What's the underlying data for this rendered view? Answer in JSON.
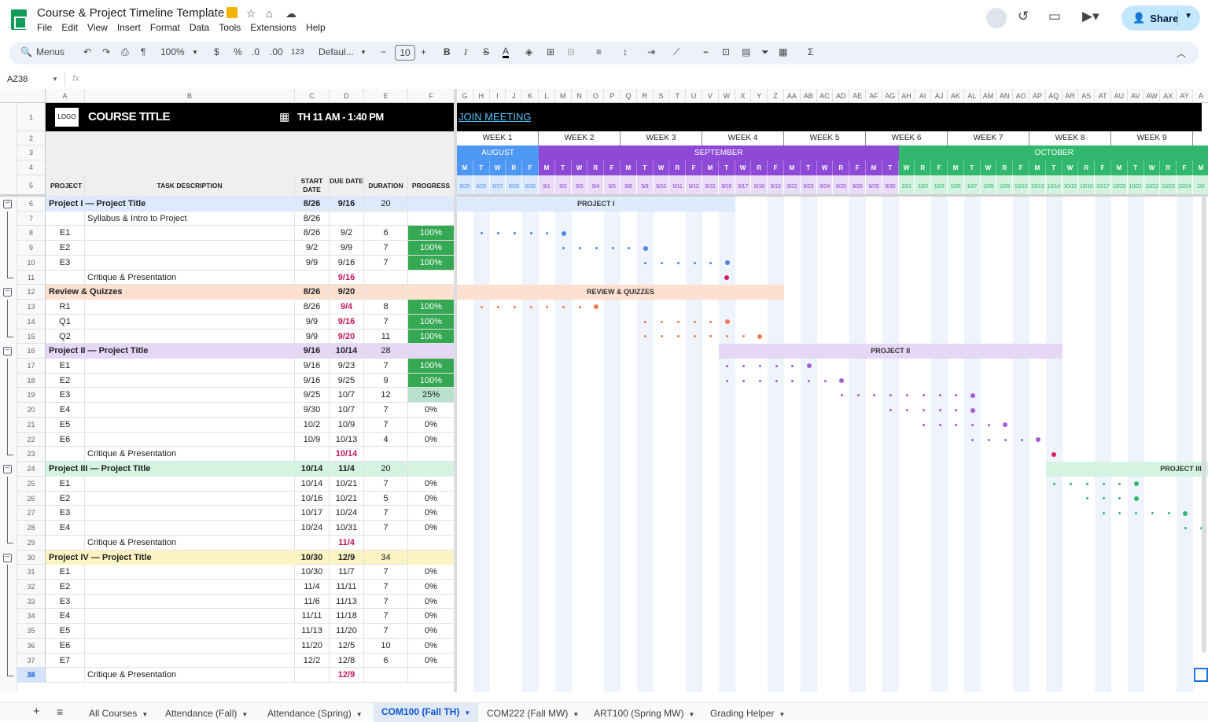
{
  "app": {
    "title": "Course & Project Timeline Template",
    "menus": [
      "File",
      "Edit",
      "View",
      "Insert",
      "Format",
      "Data",
      "Tools",
      "Extensions",
      "Help"
    ],
    "share_label": "Share"
  },
  "toolbar": {
    "menus_label": "Menus",
    "zoom": "100%",
    "currency": "$",
    "percent": "%",
    "dec_down": ".0",
    "dec_up": ".00",
    "number_format": "123",
    "font": "Defaul...",
    "font_size": "10",
    "minus": "−",
    "plus": "+",
    "bold": "B",
    "italic": "I",
    "strike": "S",
    "text_color": "A",
    "sum": "Σ"
  },
  "formula_bar": {
    "cell_ref": "AZ38",
    "fx": "fx"
  },
  "columns_left": [
    {
      "letter": "A",
      "w": 50
    },
    {
      "letter": "B",
      "w": 267
    },
    {
      "letter": "C",
      "w": 44
    },
    {
      "letter": "D",
      "w": 44
    },
    {
      "letter": "E",
      "w": 56
    },
    {
      "letter": "F",
      "w": 58
    }
  ],
  "columns_right": [
    "G",
    "H",
    "I",
    "J",
    "K",
    "L",
    "M",
    "N",
    "O",
    "P",
    "Q",
    "R",
    "S",
    "T",
    "U",
    "V",
    "W",
    "X",
    "Y",
    "Z",
    "AA",
    "AB",
    "AC",
    "AD",
    "AE",
    "AF",
    "AG",
    "AH",
    "AI",
    "AJ",
    "AK",
    "AL",
    "AM",
    "AN",
    "AO",
    "AP",
    "AQ",
    "AR",
    "AS",
    "AT",
    "AU",
    "AV",
    "AW",
    "AX",
    "AY",
    "A"
  ],
  "header": {
    "logo": "LOGO",
    "course_title": "COURSE TITLE",
    "schedule": "TH 11 AM - 1:40 PM",
    "join": "JOIN MEETING",
    "col_project": "PROJECT",
    "col_task": "TASK DESCRIPTION",
    "col_start": "START DATE",
    "col_due": "DUE DATE",
    "col_duration": "DURATION",
    "col_progress": "PROGRESS"
  },
  "weeks": [
    "WEEK 1",
    "WEEK 2",
    "WEEK 3",
    "WEEK 4",
    "WEEK 5",
    "WEEK 6",
    "WEEK 7",
    "WEEK 8",
    "WEEK 9"
  ],
  "months": [
    {
      "name": "AUGUST",
      "color": "#4f97f5",
      "start": 0,
      "span": 5
    },
    {
      "name": "SEPTEMBER",
      "color": "#8e4ad6",
      "start": 5,
      "span": 22
    },
    {
      "name": "OCTOBER",
      "color": "#31b86e",
      "start": 27,
      "span": 19
    }
  ],
  "days": [
    "M",
    "T",
    "W",
    "R",
    "F",
    "M",
    "T",
    "W",
    "R",
    "F",
    "M",
    "T",
    "W",
    "R",
    "F",
    "M",
    "T",
    "W",
    "R",
    "F",
    "M",
    "T",
    "W",
    "R",
    "F",
    "M",
    "T",
    "W",
    "R",
    "F",
    "M",
    "T",
    "W",
    "R",
    "F",
    "M",
    "T",
    "W",
    "R",
    "F",
    "M",
    "T",
    "W",
    "R",
    "F",
    "M"
  ],
  "dates": [
    "8/25",
    "8/26",
    "8/27",
    "8/28",
    "8/29",
    "9/1",
    "9/2",
    "9/3",
    "9/4",
    "9/5",
    "9/8",
    "9/9",
    "9/10",
    "9/11",
    "9/12",
    "9/15",
    "9/16",
    "9/17",
    "9/18",
    "9/19",
    "9/22",
    "9/23",
    "9/24",
    "9/25",
    "9/26",
    "9/29",
    "9/30",
    "10/1",
    "10/2",
    "10/3",
    "10/6",
    "10/7",
    "10/8",
    "10/9",
    "10/10",
    "10/13",
    "10/14",
    "10/15",
    "10/16",
    "10/17",
    "10/20",
    "10/21",
    "10/22",
    "10/23",
    "10/24",
    "10/"
  ],
  "rows": [
    {
      "n": "6",
      "kind": "section",
      "project": "Project I — Project Title",
      "start": "8/26",
      "due": "9/16",
      "duration": "20",
      "bg": "#dceafb",
      "bar": {
        "label": "PROJECT I",
        "from": 0,
        "to": 17
      }
    },
    {
      "n": "7",
      "kind": "task",
      "task": "Syllabus & Intro to Project",
      "start": "8/26"
    },
    {
      "n": "8",
      "kind": "item",
      "project": "E1",
      "start": "8/26",
      "due": "9/2",
      "duration": "6",
      "progress": "100%",
      "dots": {
        "from": 1,
        "to": 6,
        "color": "#4a86e8"
      }
    },
    {
      "n": "9",
      "kind": "item",
      "project": "E2",
      "start": "9/2",
      "due": "9/9",
      "duration": "7",
      "progress": "100%",
      "dots": {
        "from": 6,
        "to": 11,
        "color": "#4a86e8"
      }
    },
    {
      "n": "10",
      "kind": "item",
      "project": "E3",
      "start": "9/9",
      "due": "9/16",
      "duration": "7",
      "progress": "100%",
      "dots": {
        "from": 11,
        "to": 16,
        "color": "#4a86e8"
      }
    },
    {
      "n": "11",
      "kind": "critique",
      "task": "Critique & Presentation",
      "due": "9/16",
      "mark": {
        "at": 16,
        "color": "#d81b60"
      }
    },
    {
      "n": "12",
      "kind": "section",
      "project": "Review & Quizzes",
      "start": "8/26",
      "due": "9/20",
      "bg": "#fce1d1",
      "bar": {
        "label": "REVIEW & QUIZZES",
        "from": 0,
        "to": 20
      }
    },
    {
      "n": "13",
      "kind": "item",
      "project": "R1",
      "start": "8/26",
      "due": "9/4",
      "duedue": true,
      "duration": "8",
      "progress": "100%",
      "dots": {
        "from": 1,
        "to": 8,
        "color": "#f07b4f"
      }
    },
    {
      "n": "14",
      "kind": "item",
      "project": "Q1",
      "start": "9/9",
      "due": "9/16",
      "duedue": true,
      "duration": "7",
      "progress": "100%",
      "dots": {
        "from": 11,
        "to": 16,
        "color": "#f07b4f"
      }
    },
    {
      "n": "15",
      "kind": "item",
      "project": "Q2",
      "start": "9/9",
      "due": "9/20",
      "duedue": true,
      "duration": "11",
      "progress": "100%",
      "dots": {
        "from": 11,
        "to": 18,
        "color": "#f07b4f"
      }
    },
    {
      "n": "16",
      "kind": "section",
      "project": "Project II — Project Title",
      "start": "9/16",
      "due": "10/14",
      "duration": "28",
      "bg": "#e6d8f5",
      "bar": {
        "label": "PROJECT II",
        "from": 16,
        "to": 37
      }
    },
    {
      "n": "17",
      "kind": "item",
      "project": "E1",
      "start": "9/16",
      "due": "9/23",
      "duration": "7",
      "progress": "100%",
      "dots": {
        "from": 16,
        "to": 21,
        "color": "#a55dd6"
      }
    },
    {
      "n": "18",
      "kind": "item",
      "project": "E2",
      "start": "9/16",
      "due": "9/25",
      "duration": "9",
      "progress": "100%",
      "dots": {
        "from": 16,
        "to": 23,
        "color": "#a55dd6"
      }
    },
    {
      "n": "19",
      "kind": "item",
      "project": "E3",
      "start": "9/25",
      "due": "10/7",
      "duration": "12",
      "progress": "25%",
      "dots": {
        "from": 23,
        "to": 31,
        "color": "#a55dd6"
      }
    },
    {
      "n": "20",
      "kind": "item",
      "project": "E4",
      "start": "9/30",
      "due": "10/7",
      "duration": "7",
      "progress": "0%",
      "dots": {
        "from": 26,
        "to": 31,
        "color": "#a55dd6"
      }
    },
    {
      "n": "21",
      "kind": "item",
      "project": "E5",
      "start": "10/2",
      "due": "10/9",
      "duration": "7",
      "progress": "0%",
      "dots": {
        "from": 28,
        "to": 33,
        "color": "#a55dd6"
      }
    },
    {
      "n": "22",
      "kind": "item",
      "project": "E6",
      "start": "10/9",
      "due": "10/13",
      "duration": "4",
      "progress": "0%",
      "dots": {
        "from": 31,
        "to": 35,
        "color": "#a55dd6"
      }
    },
    {
      "n": "23",
      "kind": "critique",
      "task": "Critique & Presentation",
      "due": "10/14",
      "mark": {
        "at": 36,
        "color": "#d81b60"
      }
    },
    {
      "n": "24",
      "kind": "section",
      "project": "Project III — Project Title",
      "start": "10/14",
      "due": "11/4",
      "duration": "20",
      "bg": "#d5f3e1",
      "bar": {
        "label": "PROJECT III",
        "from": 36,
        "to": 46
      }
    },
    {
      "n": "25",
      "kind": "item",
      "project": "E1",
      "start": "10/14",
      "due": "10/21",
      "duration": "7",
      "progress": "0%",
      "dots": {
        "from": 36,
        "to": 41,
        "color": "#31b86e"
      }
    },
    {
      "n": "26",
      "kind": "item",
      "project": "E2",
      "start": "10/16",
      "due": "10/21",
      "duration": "5",
      "progress": "0%",
      "dots": {
        "from": 38,
        "to": 41,
        "color": "#31b86e"
      }
    },
    {
      "n": "27",
      "kind": "item",
      "project": "E3",
      "start": "10/17",
      "due": "10/24",
      "duration": "7",
      "progress": "0%",
      "dots": {
        "from": 39,
        "to": 44,
        "color": "#31b86e"
      }
    },
    {
      "n": "28",
      "kind": "item",
      "project": "E4",
      "start": "10/24",
      "due": "10/31",
      "duration": "7",
      "progress": "0%",
      "dots": {
        "from": 44,
        "to": 46,
        "color": "#31b86e"
      }
    },
    {
      "n": "29",
      "kind": "critique",
      "task": "Critique & Presentation",
      "due": "11/4"
    },
    {
      "n": "30",
      "kind": "section",
      "project": "Project IV — Project Title",
      "start": "10/30",
      "due": "12/9",
      "duration": "34",
      "bg": "#fcf3c2"
    },
    {
      "n": "31",
      "kind": "item",
      "project": "E1",
      "start": "10/30",
      "due": "11/7",
      "duration": "7",
      "progress": "0%"
    },
    {
      "n": "32",
      "kind": "item",
      "project": "E2",
      "start": "11/4",
      "due": "11/11",
      "duration": "7",
      "progress": "0%"
    },
    {
      "n": "33",
      "kind": "item",
      "project": "E3",
      "start": "11/6",
      "due": "11/13",
      "duration": "7",
      "progress": "0%"
    },
    {
      "n": "34",
      "kind": "item",
      "project": "E4",
      "start": "11/11",
      "due": "11/18",
      "duration": "7",
      "progress": "0%"
    },
    {
      "n": "35",
      "kind": "item",
      "project": "E5",
      "start": "11/13",
      "due": "11/20",
      "duration": "7",
      "progress": "0%"
    },
    {
      "n": "36",
      "kind": "item",
      "project": "E6",
      "start": "11/20",
      "due": "12/5",
      "duration": "10",
      "progress": "0%"
    },
    {
      "n": "37",
      "kind": "item",
      "project": "E7",
      "start": "12/2",
      "due": "12/8",
      "duration": "6",
      "progress": "0%"
    },
    {
      "n": "38",
      "kind": "critique",
      "task": "Critique & Presentation",
      "due": "12/9"
    }
  ],
  "sheet_tabs": [
    {
      "label": "All Courses",
      "active": false
    },
    {
      "label": "Attendance (Fall)",
      "active": false
    },
    {
      "label": "Attendance (Spring)",
      "active": false
    },
    {
      "label": "COM100 (Fall TH)",
      "active": true
    },
    {
      "label": "COM222 (Fall MW)",
      "active": false
    },
    {
      "label": "ART100 (Spring MW)",
      "active": false
    },
    {
      "label": "Grading Helper",
      "active": false
    }
  ],
  "colors": {
    "header_black": "#000000",
    "progress_green": "#34a853",
    "progress_light": "#b7e1cd",
    "due_pink": "#c2185b"
  }
}
